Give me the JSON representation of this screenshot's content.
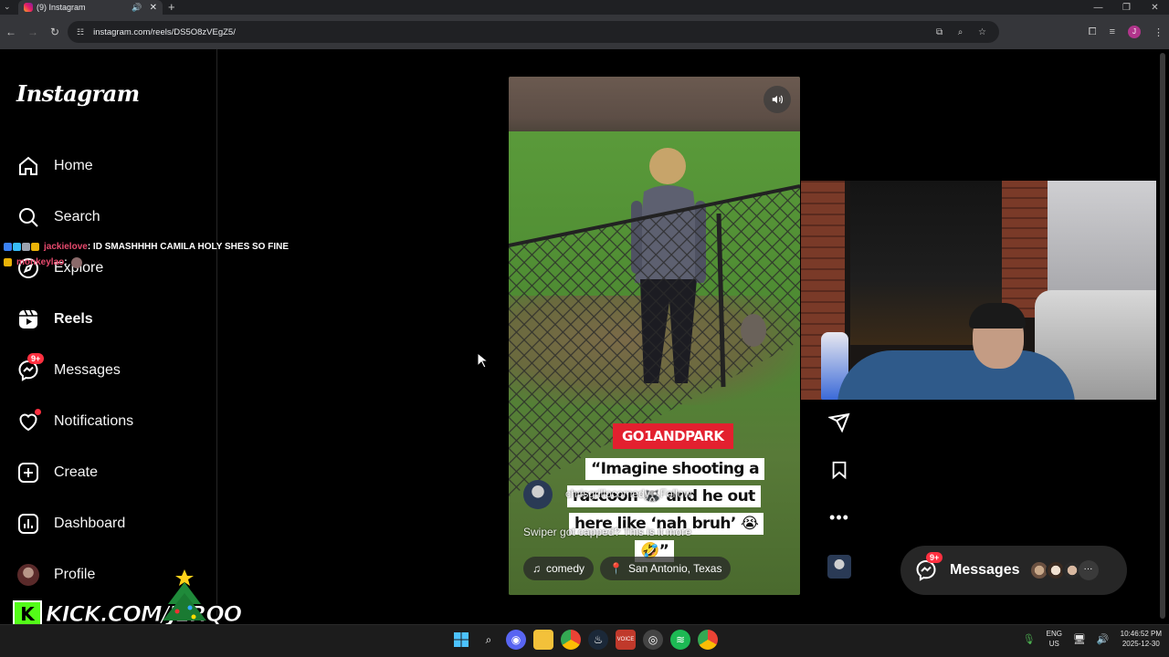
{
  "browser": {
    "tab_title": "(9) Instagram",
    "url": "instagram.com/reels/DS5O8zVEgZ5/",
    "profile_initial": "J"
  },
  "sidebar": {
    "logo": "Instagram",
    "items": [
      {
        "label": "Home",
        "icon": "home-icon"
      },
      {
        "label": "Search",
        "icon": "search-icon"
      },
      {
        "label": "Explore",
        "icon": "compass-icon"
      },
      {
        "label": "Reels",
        "icon": "reels-icon",
        "active": true
      },
      {
        "label": "Messages",
        "icon": "messenger-icon",
        "badge": "9+"
      },
      {
        "label": "Notifications",
        "icon": "heart-icon"
      },
      {
        "label": "Create",
        "icon": "plus-square-icon"
      },
      {
        "label": "Dashboard",
        "icon": "dashboard-icon"
      },
      {
        "label": "Profile",
        "icon": "profile-avatar"
      }
    ]
  },
  "chat": [
    {
      "user": "jackielove",
      "message": ": ID SMASHHHH CAMILA HOLY SHES SO FINE"
    },
    {
      "user": "monkeylao",
      "message": ":"
    }
  ],
  "reel": {
    "tag": "GO1ANDPARK",
    "caption_lines": [
      "“Imagine shooting a",
      "raccoon 🦝 and he out",
      "here like ‘nah bruh’ 😭",
      "🤣”"
    ],
    "author": "chrisgrillocomedy • Follow",
    "description": "Swiper got capped? This is it more",
    "audio": "comedy",
    "location": "San Antonio, Texas"
  },
  "messages_pill": {
    "label": "Messages",
    "badge": "9+"
  },
  "overlay": {
    "kick_text": "KICK.COM/JERQO",
    "kick_logo": "K"
  },
  "taskbar": {
    "lang_top": "ENG",
    "lang_bottom": "US",
    "time": "10:46:52 PM",
    "date": "2025-12-30"
  },
  "colors": {
    "accent_red": "#ff3040",
    "kick_green": "#53fc18",
    "tag_red": "#e3202f"
  }
}
